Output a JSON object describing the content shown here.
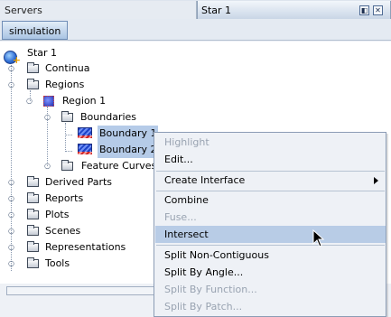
{
  "tabs": {
    "servers_label": "Servers",
    "star1_label": "Star 1",
    "restore_glyph": "◧",
    "close_glyph": "✕"
  },
  "toolbar": {
    "simulation_label": "simulation"
  },
  "tree": {
    "root_label": "Star 1",
    "continua_label": "Continua",
    "regions_label": "Regions",
    "region1_label": "Region 1",
    "boundaries_label": "Boundaries",
    "boundary1_label": "Boundary 1",
    "boundary2_label": "Boundary 2",
    "feature_curves_label": "Feature Curves",
    "derived_parts_label": "Derived Parts",
    "reports_label": "Reports",
    "plots_label": "Plots",
    "scenes_label": "Scenes",
    "representations_label": "Representations",
    "tools_label": "Tools"
  },
  "context_menu": {
    "highlight": "Highlight",
    "edit": "Edit...",
    "create_interface": "Create Interface",
    "combine": "Combine",
    "fuse": "Fuse...",
    "intersect": "Intersect",
    "split_non_contiguous": "Split Non-Contiguous",
    "split_by_angle": "Split By Angle...",
    "split_by_function": "Split By Function...",
    "split_by_patch": "Split By Patch..."
  },
  "colors": {
    "selection": "#b5cbe8",
    "menu_hover": "#b8cce6",
    "disabled_text": "#99a3b1"
  }
}
